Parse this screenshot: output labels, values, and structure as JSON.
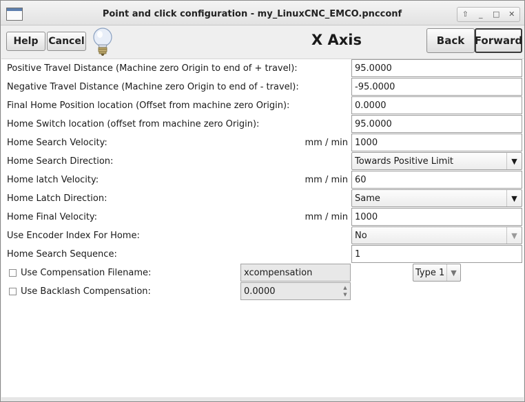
{
  "window": {
    "title": "Point and click configuration - my_LinuxCNC_EMCO.pncconf",
    "controls": {
      "shade": "⇧",
      "minimize": "_",
      "maximize": "□",
      "close": "✕"
    }
  },
  "toolbar": {
    "help_label": "Help",
    "cancel_label": "Cancel",
    "page_title": "X Axis",
    "back_label": "Back",
    "forward_label": "Forward"
  },
  "form": {
    "positive_travel": {
      "label": "Positive Travel Distance  (Machine zero Origin to end of + travel):",
      "value": "95.0000"
    },
    "negative_travel": {
      "label": "Negative Travel Distance  (Machine zero Origin to end of - travel):",
      "value": "-95.0000"
    },
    "final_home": {
      "label": "Final Home Position location   (Offset from machine zero Origin):",
      "value": "0.0000"
    },
    "home_switch": {
      "label": "Home Switch location   (offset from machine zero Origin):",
      "value": "95.0000"
    },
    "home_search_velocity": {
      "label": "Home Search Velocity:",
      "unit": "mm / min",
      "value": "1000"
    },
    "home_search_direction": {
      "label": "Home Search Direction:",
      "value": "Towards Positive Limit"
    },
    "home_latch_velocity": {
      "label": "Home latch Velocity:",
      "unit": "mm / min",
      "value": "60"
    },
    "home_latch_direction": {
      "label": "Home Latch Direction:",
      "value": "Same"
    },
    "home_final_velocity": {
      "label": "Home Final Velocity:",
      "unit": "mm / min",
      "value": "1000"
    },
    "use_encoder_index": {
      "label": "Use Encoder Index For Home:",
      "value": "No"
    },
    "home_search_sequence": {
      "label": "Home Search Sequence:",
      "value": "1"
    },
    "compensation_file": {
      "label": "Use Compensation Filename:",
      "value": "xcompensation",
      "type_value": "Type 1"
    },
    "backlash": {
      "label": "Use Backlash Compensation:",
      "value": "0.0000"
    }
  },
  "icons": {
    "dropdown": "▼",
    "spin_up": "▲",
    "spin_down": "▼"
  },
  "colors": {
    "accent": "#5d7fae",
    "bulb": "#e8eef8"
  }
}
